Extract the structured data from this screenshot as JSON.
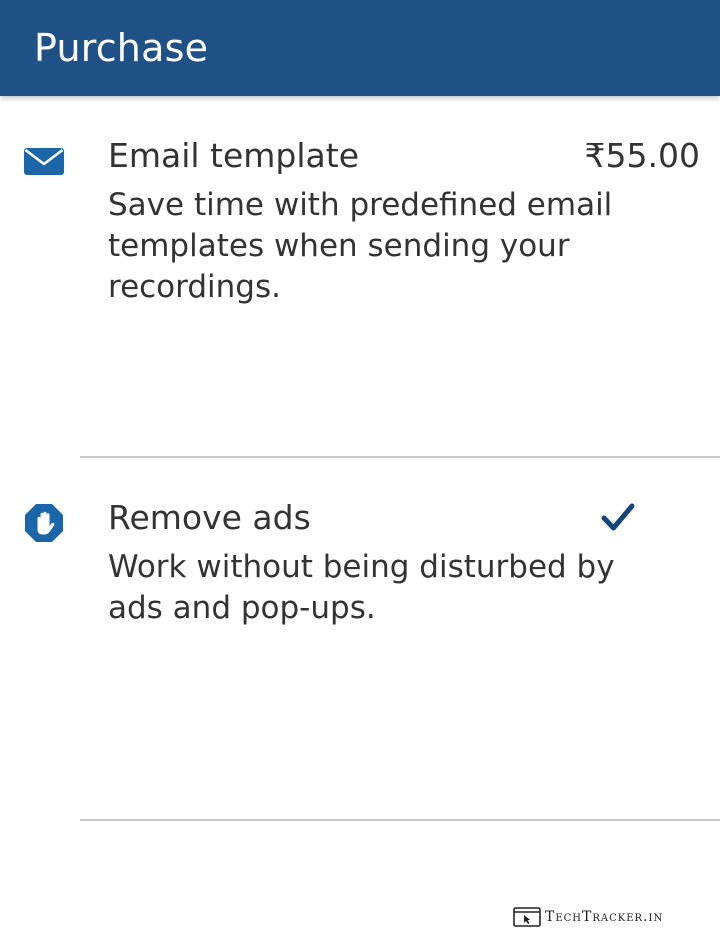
{
  "header": {
    "title": "Purchase"
  },
  "items": [
    {
      "icon": "envelope-icon",
      "title": "Email template",
      "price": "₹55.00",
      "description": "Save time with predefined email templates when sending your recordings."
    },
    {
      "icon": "hand-stop-icon",
      "title": "Remove ads",
      "status": "purchased",
      "description": "Work without being disturbed by ads and pop-ups."
    }
  ],
  "watermark": {
    "text": "TechTracker.in"
  },
  "colors": {
    "header_bg": "#1f5186",
    "accent": "#1a66a8",
    "check": "#15447a",
    "text": "#333333",
    "divider": "#c9c9c9"
  }
}
